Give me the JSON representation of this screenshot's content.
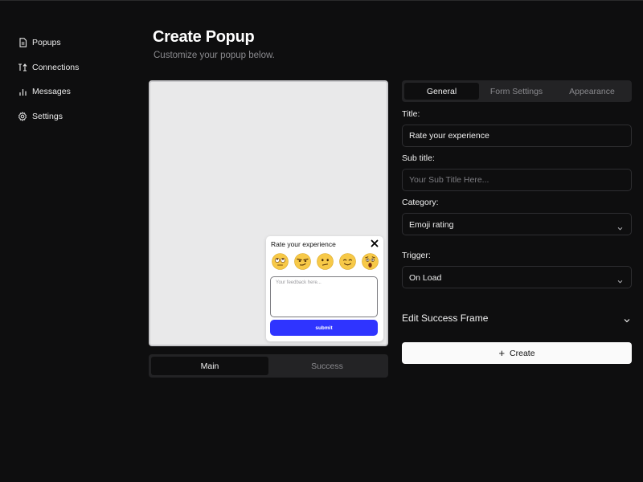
{
  "sidebar": {
    "items": [
      {
        "label": "Popups",
        "icon": "document-icon"
      },
      {
        "label": "Connections",
        "icon": "connections-icon"
      },
      {
        "label": "Messages",
        "icon": "bar-chart-icon"
      },
      {
        "label": "Settings",
        "icon": "gear-icon"
      }
    ]
  },
  "header": {
    "title": "Create Popup",
    "subtitle": "Customize your popup below."
  },
  "preview": {
    "popup": {
      "title": "Rate your experience",
      "emojis": [
        "rolling-eyes-emoji-icon",
        "smirk-emoji-icon",
        "neutral-emoji-icon",
        "smile-emoji-icon",
        "surprised-emoji-icon"
      ],
      "feedback_placeholder": "Your feedback here...",
      "submit_label": "submit",
      "submit_color": "#2f34ff"
    },
    "frame_tabs": [
      {
        "label": "Main",
        "active": true
      },
      {
        "label": "Success",
        "active": false
      }
    ]
  },
  "settings": {
    "tabs": [
      {
        "label": "General",
        "active": true
      },
      {
        "label": "Form Settings",
        "active": false
      },
      {
        "label": "Appearance",
        "active": false
      }
    ],
    "title_label": "Title:",
    "title_value": "Rate your experience",
    "subtitle_label": "Sub title:",
    "subtitle_placeholder": "Your Sub Title Here...",
    "category_label": "Category:",
    "category_value": "Emoji rating",
    "trigger_label": "Trigger:",
    "trigger_value": "On Load",
    "success_frame_label": "Edit Success Frame",
    "create_label": "Create"
  }
}
